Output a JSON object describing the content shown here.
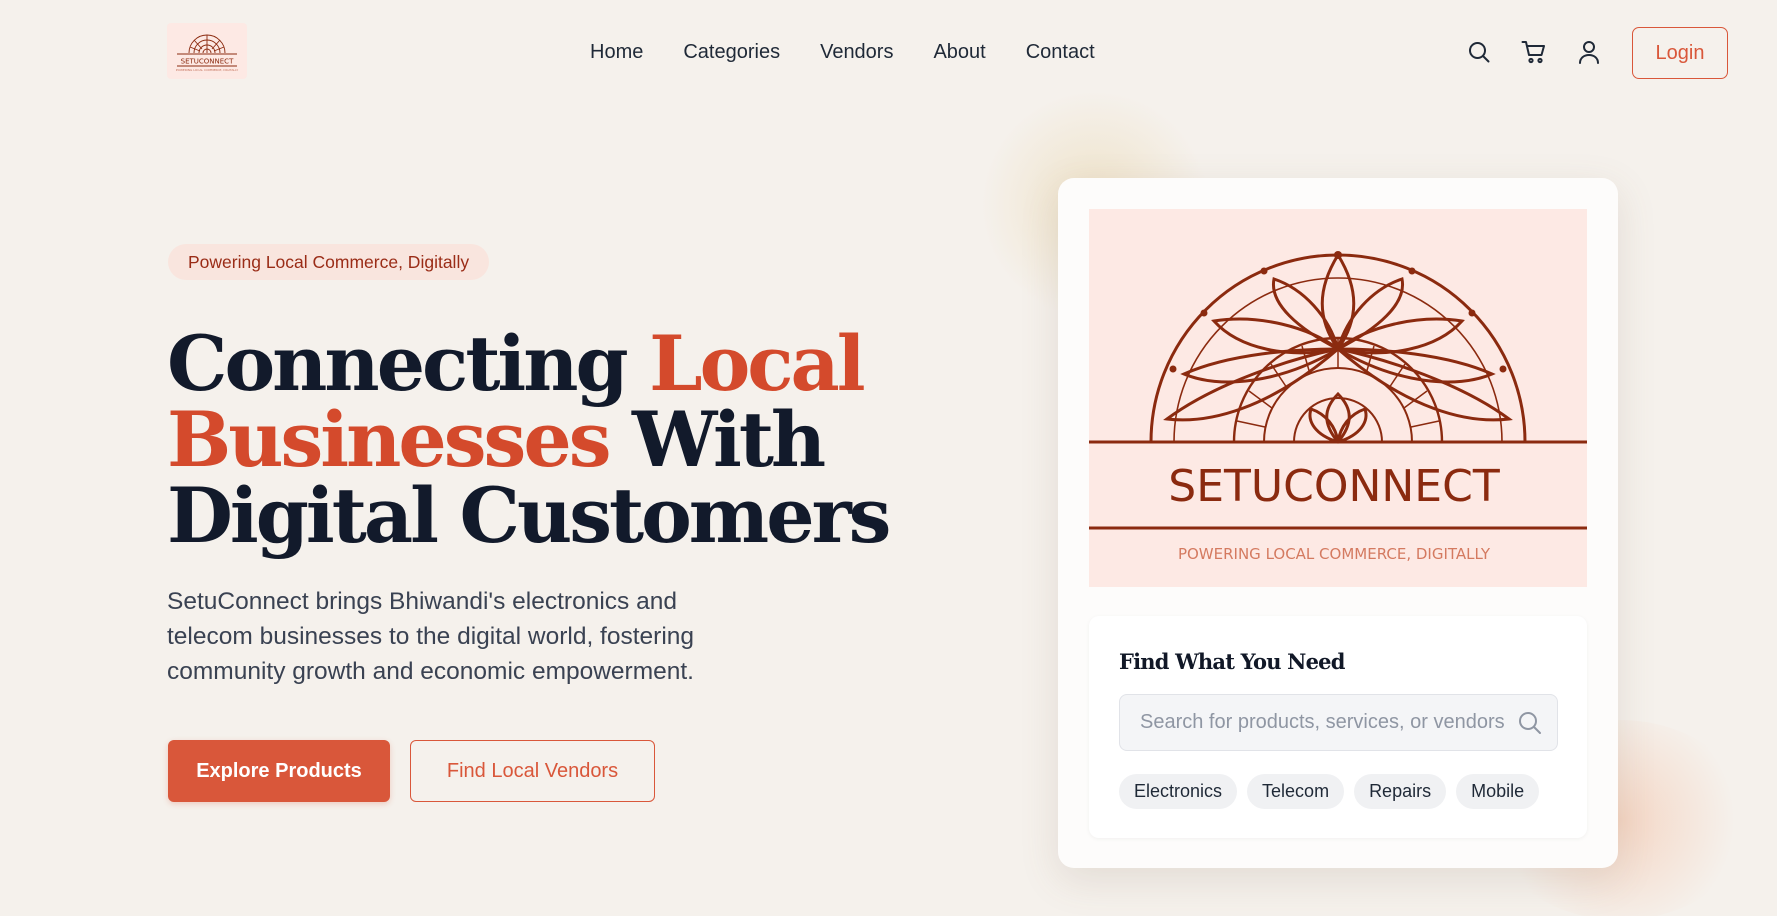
{
  "brand": {
    "logo_text": "SETUCONNECT",
    "tagline": "POWERING LOCAL COMMERCE, DIGITALLY"
  },
  "nav": {
    "items": [
      {
        "label": "Home"
      },
      {
        "label": "Categories"
      },
      {
        "label": "Vendors"
      },
      {
        "label": "About"
      },
      {
        "label": "Contact"
      }
    ],
    "icons": [
      "search-icon",
      "cart-icon",
      "user-icon"
    ],
    "login_label": "Login"
  },
  "hero": {
    "badge": "Powering Local Commerce, Digitally",
    "headline": {
      "part1": "Connecting ",
      "accent1": "Local",
      "accent2": "Businesses",
      "part2": " With Digital Customers"
    },
    "description": "SetuConnect brings Bhiwandi's electronics and telecom businesses to the digital world, fostering community growth and economic empowerment.",
    "primary_cta": "Explore Products",
    "secondary_cta": "Find Local Vendors"
  },
  "card": {
    "title": "Find What You Need",
    "search_placeholder": "Search for products, services, or vendors",
    "tags": [
      "Electronics",
      "Telecom",
      "Repairs",
      "Mobile"
    ]
  },
  "colors": {
    "accent": "#d9573a",
    "headline_accent": "#d44a2c",
    "background": "#f5f1ec",
    "logo_maroon": "#8b2a0f"
  }
}
